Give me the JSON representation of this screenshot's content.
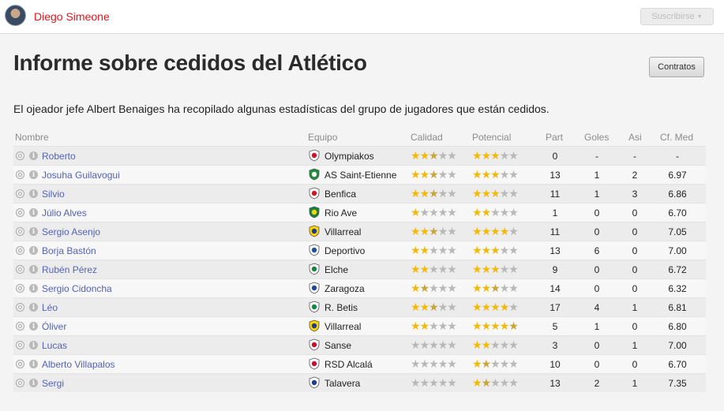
{
  "header": {
    "manager_name": "Diego Simeone",
    "subscribe_label": "Suscribirse",
    "subscribe_caret": "▼"
  },
  "page": {
    "title": "Informe sobre cedidos del Atlético",
    "contracts_label": "Contratos",
    "intro": "El ojeador jefe Albert Benaiges ha recopilado algunas estadísticas del grupo de jugadores que están cedidos."
  },
  "colors": {
    "star_filled": "#f2b90c",
    "star_half": "#c9a43a",
    "star_empty": "#b8b8b8",
    "link": "#5262b9",
    "accent_red": "#e2151d"
  },
  "table": {
    "columns": {
      "name": "Nombre",
      "club": "Equipo",
      "ability": "Calidad",
      "potential": "Potencial",
      "apps": "Part",
      "goals": "Goles",
      "assists": "Asi",
      "rating": "Cf. Med"
    },
    "rows": [
      {
        "name": "Roberto",
        "club": "Olympiakos",
        "crest": {
          "bg": "#ffffff",
          "fg": "#d0102a"
        },
        "ability": 2.5,
        "potential": 3,
        "apps": "0",
        "goals": "-",
        "assists": "-",
        "rating": "-"
      },
      {
        "name": "Josuha Guilavogui",
        "club": "AS Saint-Etienne",
        "crest": {
          "bg": "#1a8f3a",
          "fg": "#ffffff"
        },
        "ability": 2.5,
        "potential": 3,
        "apps": "13",
        "goals": "1",
        "assists": "2",
        "rating": "6.97"
      },
      {
        "name": "Silvio",
        "club": "Benfica",
        "crest": {
          "bg": "#ffffff",
          "fg": "#d2141f"
        },
        "ability": 2.5,
        "potential": 3,
        "apps": "11",
        "goals": "1",
        "assists": "3",
        "rating": "6.86"
      },
      {
        "name": "Júlio Alves",
        "club": "Rio Ave",
        "crest": {
          "bg": "#16803c",
          "fg": "#ffd300"
        },
        "ability": 1,
        "potential": 2,
        "apps": "1",
        "goals": "0",
        "assists": "0",
        "rating": "6.70"
      },
      {
        "name": "Sergio Asenjo",
        "club": "Villarreal",
        "crest": {
          "bg": "#ffd400",
          "fg": "#1e3d8f"
        },
        "ability": 2.5,
        "potential": 4,
        "apps": "11",
        "goals": "0",
        "assists": "0",
        "rating": "7.05"
      },
      {
        "name": "Borja Bastón",
        "club": "Deportivo",
        "crest": {
          "bg": "#ffffff",
          "fg": "#1d4fa3"
        },
        "ability": 2,
        "potential": 3,
        "apps": "13",
        "goals": "6",
        "assists": "0",
        "rating": "7.00"
      },
      {
        "name": "Rubén Pérez",
        "club": "Elche",
        "crest": {
          "bg": "#ffffff",
          "fg": "#16823a"
        },
        "ability": 2,
        "potential": 3,
        "apps": "9",
        "goals": "0",
        "assists": "0",
        "rating": "6.72"
      },
      {
        "name": "Sergio Cidoncha",
        "club": "Zaragoza",
        "crest": {
          "bg": "#ffffff",
          "fg": "#1d48a0"
        },
        "ability": 1.5,
        "potential": 2.5,
        "apps": "14",
        "goals": "0",
        "assists": "0",
        "rating": "6.32"
      },
      {
        "name": "Léo",
        "club": "R. Betis",
        "crest": {
          "bg": "#ffffff",
          "fg": "#0a8c3e"
        },
        "ability": 2.5,
        "potential": 4,
        "apps": "17",
        "goals": "4",
        "assists": "1",
        "rating": "6.81"
      },
      {
        "name": "Óliver",
        "club": "Villarreal",
        "crest": {
          "bg": "#ffd400",
          "fg": "#1e3d8f"
        },
        "ability": 2,
        "potential": 4.5,
        "apps": "5",
        "goals": "1",
        "assists": "0",
        "rating": "6.80"
      },
      {
        "name": "Lucas",
        "club": "Sanse",
        "crest": {
          "bg": "#ffffff",
          "fg": "#c8102e"
        },
        "ability": 0,
        "potential": 2,
        "apps": "3",
        "goals": "0",
        "assists": "1",
        "rating": "7.00"
      },
      {
        "name": "Alberto Villapalos",
        "club": "RSD Alcalá",
        "crest": {
          "bg": "#ffffff",
          "fg": "#c8102e"
        },
        "ability": 0,
        "potential": 1.5,
        "apps": "10",
        "goals": "0",
        "assists": "0",
        "rating": "6.70"
      },
      {
        "name": "Sergi",
        "club": "Talavera",
        "crest": {
          "bg": "#ffffff",
          "fg": "#1b3f8c"
        },
        "ability": 0,
        "potential": 1.5,
        "apps": "13",
        "goals": "2",
        "assists": "1",
        "rating": "7.35"
      }
    ]
  },
  "icons": {
    "avatar": "manager-face-icon",
    "row_target": "scout-target-icon",
    "row_info": "info-icon",
    "crest": "club-crest-icon",
    "star": "star-icon"
  }
}
